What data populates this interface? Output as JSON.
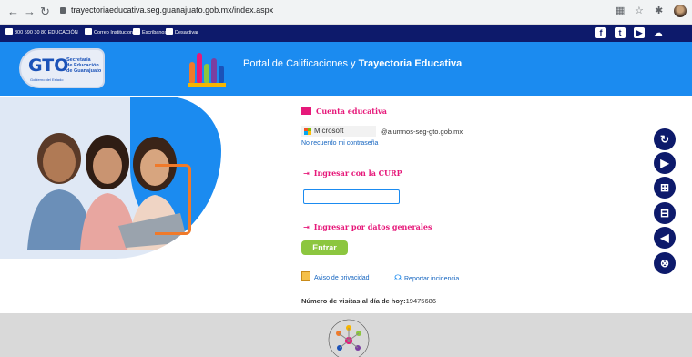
{
  "browser": {
    "url": "trayectoriaeducativa.seg.guanajuato.gob.mx/index.aspx"
  },
  "topbar": {
    "phone": "800 590 30 80 EDUCACIÓN",
    "mail": "Correo Institucional",
    "writers": "Escribanos",
    "disable": "Desactivar"
  },
  "header": {
    "logo_text": "GTO",
    "logo_sub": "Gobierno del Estado",
    "logo_dep_1": "Secretaría",
    "logo_dep_2": "de Educación",
    "logo_dep_3": "de Guanajuato",
    "portal_prefix": "Portal de Calificaciones y ",
    "portal_bold": "Trayectoria Educativa"
  },
  "login": {
    "cuenta_educativa": "Cuenta educativa",
    "microsoft_label": "Microsoft",
    "domain": "@alumnos-seg-gto.gob.mx",
    "forgot": "No recuerdo mi contraseña",
    "curp_label": "Ingresar con la CURP",
    "curp_value": "",
    "datos_label": "Ingresar por datos generales",
    "submit": "Entrar",
    "privacy": "Aviso de privacidad",
    "report": "Reportar incidencia",
    "visits_label": "Número de visitas al día de hoy:",
    "visits_value": "19475686"
  },
  "accessibility": [
    "refresh-icon",
    "play-icon",
    "zoom-in-icon",
    "zoom-out-icon",
    "audio-icon",
    "close-icon"
  ],
  "colors": {
    "header_blue": "#1b8bf0",
    "topbar_navy": "#0d1a6b",
    "pink": "#e6197a",
    "green": "#8cc63f"
  }
}
